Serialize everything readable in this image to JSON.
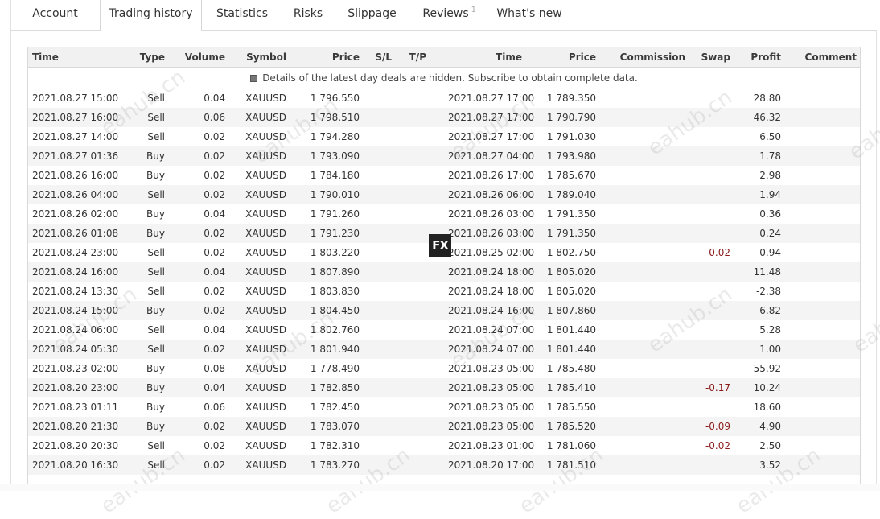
{
  "tabs": [
    {
      "label": "Account"
    },
    {
      "label": "Trading history",
      "active": true
    },
    {
      "label": "Statistics"
    },
    {
      "label": "Risks"
    },
    {
      "label": "Slippage"
    },
    {
      "label": "Reviews",
      "badge": "1"
    },
    {
      "label": "What's new"
    }
  ],
  "columns": [
    "Time",
    "Type",
    "Volume",
    "Symbol",
    "Price",
    "S/L",
    "T/P",
    "Time",
    "Price",
    "Commission",
    "Swap",
    "Profit",
    "Comment"
  ],
  "notice": "Details of the latest day deals are hidden. Subscribe to obtain complete data.",
  "rows": [
    {
      "open_time": "2021.08.27 15:00",
      "type": "Sell",
      "volume": "0.04",
      "symbol": "XAUUSD",
      "price": "1 796.550",
      "close_time": "2021.08.27 17:00",
      "close_price": "1 789.350",
      "swap": "",
      "profit": "28.80"
    },
    {
      "open_time": "2021.08.27 16:00",
      "type": "Sell",
      "volume": "0.06",
      "symbol": "XAUUSD",
      "price": "1 798.510",
      "close_time": "2021.08.27 17:00",
      "close_price": "1 790.790",
      "swap": "",
      "profit": "46.32"
    },
    {
      "open_time": "2021.08.27 14:00",
      "type": "Sell",
      "volume": "0.02",
      "symbol": "XAUUSD",
      "price": "1 794.280",
      "close_time": "2021.08.27 17:00",
      "close_price": "1 791.030",
      "swap": "",
      "profit": "6.50"
    },
    {
      "open_time": "2021.08.27 01:36",
      "type": "Buy",
      "volume": "0.02",
      "symbol": "XAUUSD",
      "price": "1 793.090",
      "close_time": "2021.08.27 04:00",
      "close_price": "1 793.980",
      "swap": "",
      "profit": "1.78"
    },
    {
      "open_time": "2021.08.26 16:00",
      "type": "Buy",
      "volume": "0.02",
      "symbol": "XAUUSD",
      "price": "1 784.180",
      "close_time": "2021.08.26 17:00",
      "close_price": "1 785.670",
      "swap": "",
      "profit": "2.98"
    },
    {
      "open_time": "2021.08.26 04:00",
      "type": "Sell",
      "volume": "0.02",
      "symbol": "XAUUSD",
      "price": "1 790.010",
      "close_time": "2021.08.26 06:00",
      "close_price": "1 789.040",
      "swap": "",
      "profit": "1.94"
    },
    {
      "open_time": "2021.08.26 02:00",
      "type": "Buy",
      "volume": "0.04",
      "symbol": "XAUUSD",
      "price": "1 791.260",
      "close_time": "2021.08.26 03:00",
      "close_price": "1 791.350",
      "swap": "",
      "profit": "0.36"
    },
    {
      "open_time": "2021.08.26 01:08",
      "type": "Buy",
      "volume": "0.02",
      "symbol": "XAUUSD",
      "price": "1 791.230",
      "close_time": "2021.08.26 03:00",
      "close_price": "1 791.350",
      "swap": "",
      "profit": "0.24"
    },
    {
      "open_time": "2021.08.24 23:00",
      "type": "Sell",
      "volume": "0.02",
      "symbol": "XAUUSD",
      "price": "1 803.220",
      "close_time": "2021.08.25 02:00",
      "close_price": "1 802.750",
      "swap": "-0.02",
      "profit": "0.94"
    },
    {
      "open_time": "2021.08.24 16:00",
      "type": "Sell",
      "volume": "0.04",
      "symbol": "XAUUSD",
      "price": "1 807.890",
      "close_time": "2021.08.24 18:00",
      "close_price": "1 805.020",
      "swap": "",
      "profit": "11.48"
    },
    {
      "open_time": "2021.08.24 13:30",
      "type": "Sell",
      "volume": "0.02",
      "symbol": "XAUUSD",
      "price": "1 803.830",
      "close_time": "2021.08.24 18:00",
      "close_price": "1 805.020",
      "swap": "",
      "profit": "-2.38"
    },
    {
      "open_time": "2021.08.24 15:00",
      "type": "Buy",
      "volume": "0.02",
      "symbol": "XAUUSD",
      "price": "1 804.450",
      "close_time": "2021.08.24 16:00",
      "close_price": "1 807.860",
      "swap": "",
      "profit": "6.82"
    },
    {
      "open_time": "2021.08.24 06:00",
      "type": "Sell",
      "volume": "0.04",
      "symbol": "XAUUSD",
      "price": "1 802.760",
      "close_time": "2021.08.24 07:00",
      "close_price": "1 801.440",
      "swap": "",
      "profit": "5.28"
    },
    {
      "open_time": "2021.08.24 05:30",
      "type": "Sell",
      "volume": "0.02",
      "symbol": "XAUUSD",
      "price": "1 801.940",
      "close_time": "2021.08.24 07:00",
      "close_price": "1 801.440",
      "swap": "",
      "profit": "1.00"
    },
    {
      "open_time": "2021.08.23 02:00",
      "type": "Buy",
      "volume": "0.08",
      "symbol": "XAUUSD",
      "price": "1 778.490",
      "close_time": "2021.08.23 05:00",
      "close_price": "1 785.480",
      "swap": "",
      "profit": "55.92"
    },
    {
      "open_time": "2021.08.20 23:00",
      "type": "Buy",
      "volume": "0.04",
      "symbol": "XAUUSD",
      "price": "1 782.850",
      "close_time": "2021.08.23 05:00",
      "close_price": "1 785.410",
      "swap": "-0.17",
      "profit": "10.24"
    },
    {
      "open_time": "2021.08.23 01:11",
      "type": "Buy",
      "volume": "0.06",
      "symbol": "XAUUSD",
      "price": "1 782.450",
      "close_time": "2021.08.23 05:00",
      "close_price": "1 785.550",
      "swap": "",
      "profit": "18.60"
    },
    {
      "open_time": "2021.08.20 21:30",
      "type": "Buy",
      "volume": "0.02",
      "symbol": "XAUUSD",
      "price": "1 783.070",
      "close_time": "2021.08.23 05:00",
      "close_price": "1 785.520",
      "swap": "-0.09",
      "profit": "4.90"
    },
    {
      "open_time": "2021.08.20 20:30",
      "type": "Sell",
      "volume": "0.02",
      "symbol": "XAUUSD",
      "price": "1 782.310",
      "close_time": "2021.08.23 01:00",
      "close_price": "1 781.060",
      "swap": "-0.02",
      "profit": "2.50"
    },
    {
      "open_time": "2021.08.20 16:30",
      "type": "Sell",
      "volume": "0.02",
      "symbol": "XAUUSD",
      "price": "1 783.270",
      "close_time": "2021.08.20 17:00",
      "close_price": "1 781.510",
      "swap": "",
      "profit": "3.52"
    }
  ],
  "overlay_logo": "FX",
  "watermark": "eahub.cn",
  "colors": {
    "negative_swap": "#8b1a1a",
    "header_bg": "#f1f1f1",
    "alt_row_bg": "#f4f4f4"
  }
}
